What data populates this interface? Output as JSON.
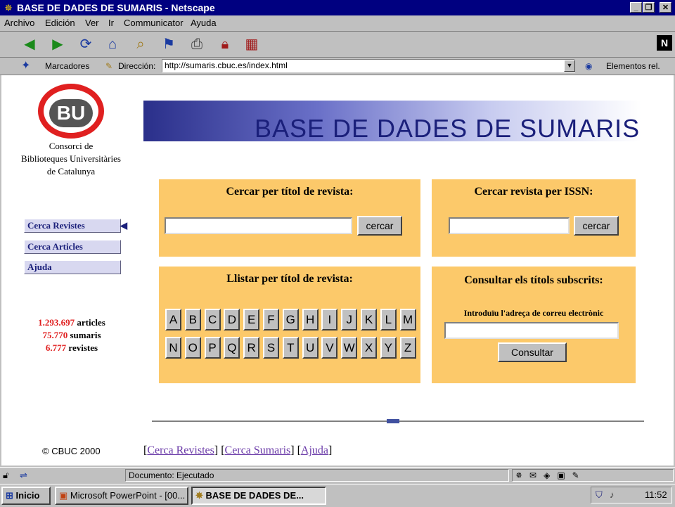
{
  "window": {
    "title": "BASE DE DADES DE SUMARIS - Netscape"
  },
  "menu": [
    "Archivo",
    "Edición",
    "Ver",
    "Ir",
    "Communicator",
    "Ayuda"
  ],
  "toolbar_icons": [
    "back-icon",
    "forward-icon",
    "reload-icon",
    "home-icon",
    "search-icon",
    "guide-icon",
    "print-icon",
    "security-icon",
    "stop-icon"
  ],
  "addressbar": {
    "bookmarks_label": "Marcadores",
    "address_label": "Dirección:",
    "url": "http://sumaris.cbuc.es/index.html",
    "related_label": "Elementos rel."
  },
  "page": {
    "logo_text": "BU",
    "org_lines": [
      "Consorci de",
      "Biblioteques Universitàries",
      "de Catalunya"
    ],
    "banner_title": "BASE DE DADES DE SUMARIS",
    "nav": [
      "Cerca Revistes",
      "Cerca Articles",
      "Ajuda"
    ],
    "stats": [
      {
        "num": "1.293.697",
        "label": "articles"
      },
      {
        "num": "75.770",
        "label": "sumaris"
      },
      {
        "num": "6.777",
        "label": "revistes"
      }
    ],
    "search_title": {
      "heading": "Cercar per títol de revista:",
      "button": "cercar",
      "value": ""
    },
    "search_issn": {
      "heading": "Cercar revista per ISSN:",
      "button": "cercar",
      "value": ""
    },
    "list_title": {
      "heading": "Llistar per títol de revista:",
      "letters_row1": [
        "A",
        "B",
        "C",
        "D",
        "E",
        "F",
        "G",
        "H",
        "I",
        "J",
        "K",
        "L",
        "M"
      ],
      "letters_row2": [
        "N",
        "O",
        "P",
        "Q",
        "R",
        "S",
        "T",
        "U",
        "V",
        "W",
        "X",
        "Y",
        "Z"
      ]
    },
    "subscribed": {
      "heading": "Consultar els títols subscrits:",
      "email_label": "Introduïu l'adreça de correu electrònic",
      "button": "Consultar",
      "value": ""
    },
    "footer": {
      "copyright": "© CBUC 2000",
      "links": [
        "Cerca Revistes",
        "Cerca Sumaris",
        "Ajuda"
      ]
    }
  },
  "status": {
    "text": "Documento: Ejecutado"
  },
  "taskbar": {
    "start": "Inicio",
    "tasks": [
      "Microsoft PowerPoint - [00...",
      "BASE DE DADES DE..."
    ],
    "clock": "11:52"
  },
  "colors": {
    "panel": "#fcc96a",
    "title_bar": "#000080",
    "stat_number": "#e02020",
    "banner_text": "#1a1f7a"
  }
}
